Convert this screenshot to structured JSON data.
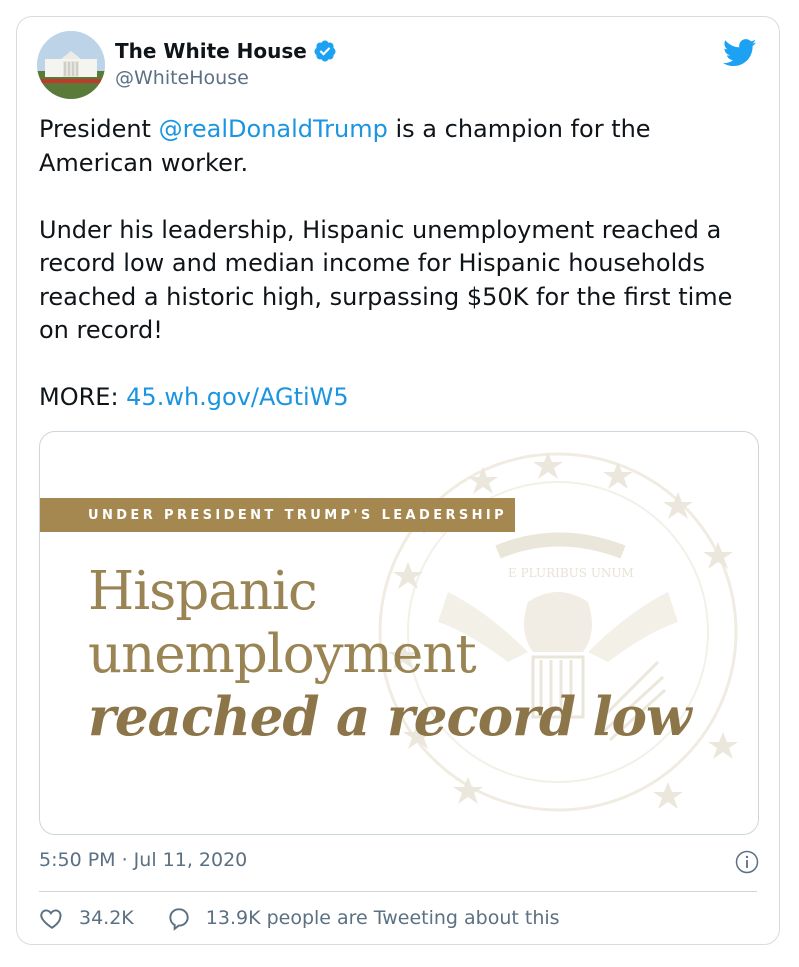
{
  "tweet": {
    "display_name": "The White House",
    "handle": "@WhiteHouse",
    "verified": true,
    "text_parts": {
      "p1_before": "President ",
      "p1_mention": "@realDonaldTrump",
      "p1_after": " is a champion for the American worker.",
      "p2": "Under his leadership, Hispanic unemployment reached a record low and median income for Hispanic households reached a historic high, surpassing $50K for the first time on record!",
      "p3_label": "MORE: ",
      "p3_link": "45.wh.gov/AGtiW5"
    },
    "timestamp": "5:50 PM · Jul 11, 2020"
  },
  "media": {
    "kicker": "UNDER PRESIDENT TRUMP'S LEADERSHIP",
    "headline_line1": "Hispanic",
    "headline_line2": "unemployment",
    "headline_line3": "reached a record low",
    "seal_text": "E PLURIBUS UNUM"
  },
  "actions": {
    "likes": "34.2K",
    "tweeting": "13.9K people are Tweeting about this"
  },
  "colors": {
    "link": "#1b95e0",
    "gold": "#a5884f",
    "verified": "#1da1f2"
  }
}
